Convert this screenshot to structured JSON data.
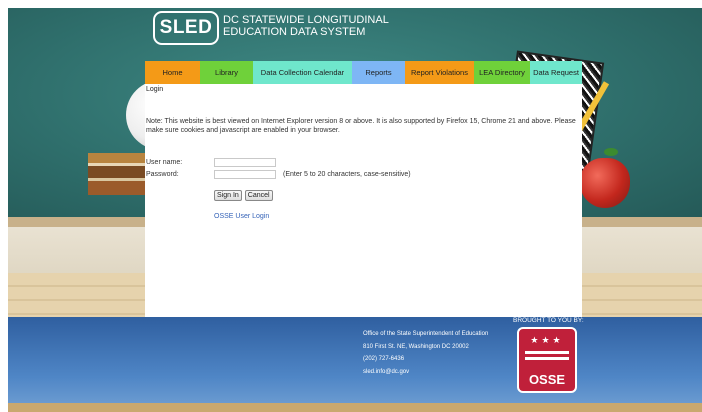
{
  "header": {
    "logo_text": "SLED",
    "title_line1": "DC STATEWIDE LONGITUDINAL",
    "title_line2": "EDUCATION DATA SYSTEM"
  },
  "nav": {
    "tabs": [
      {
        "label": "Home",
        "color": "#f49a17"
      },
      {
        "label": "Library",
        "color": "#6fd13a"
      },
      {
        "label": "Data Collection Calendar",
        "color": "#6fe7cc"
      },
      {
        "label": "Reports",
        "color": "#7eb6f5"
      },
      {
        "label": "Report Violations",
        "color": "#f49a17"
      },
      {
        "label": "LEA Directory",
        "color": "#6fd13a"
      },
      {
        "label": "Data Request",
        "color": "#6fe7cc"
      }
    ]
  },
  "breadcrumb": "Login",
  "note": "Note: This website is best viewed on Internet Explorer version 8 or above. It is also supported by Firefox 15, Chrome 21 and above. Please make sure cookies and javascript are enabled in your browser.",
  "login": {
    "username_label": "User name:",
    "username_value": "",
    "password_label": "Password:",
    "password_value": "",
    "password_hint": "(Enter 5 to 20 characters, case-sensitive)",
    "signin_label": "Sign In",
    "cancel_label": "Cancel",
    "osse_link": "OSSE User Login"
  },
  "footer": {
    "org": "Office of the State Superintendent of Education",
    "address": "810 First St. NE, Washington DC 20002",
    "phone": "(202) 727-6436",
    "email": "sled.info@dc.gov",
    "brought_by": "BROUGHT TO YOU BY:",
    "logo_word": "OSSE",
    "logo_stars": "★★★"
  }
}
